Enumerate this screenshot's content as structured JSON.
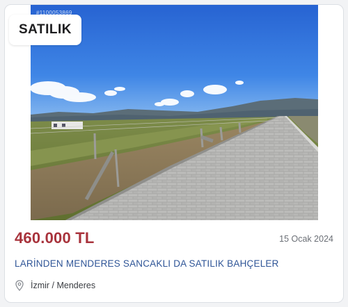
{
  "listing": {
    "id_label": "#1100053869",
    "status_badge": "SATILIK",
    "price": "460.000 TL",
    "date": "15 Ocak 2024",
    "title": "LARİNDEN MENDERES SANCAKLI DA SATILIK BAHÇELER",
    "location": "İzmir / Menderes",
    "location_icon": "map-pin-icon"
  },
  "colors": {
    "price": "#a8333c",
    "title": "#2f5597",
    "sky": "#2f6fd6"
  }
}
